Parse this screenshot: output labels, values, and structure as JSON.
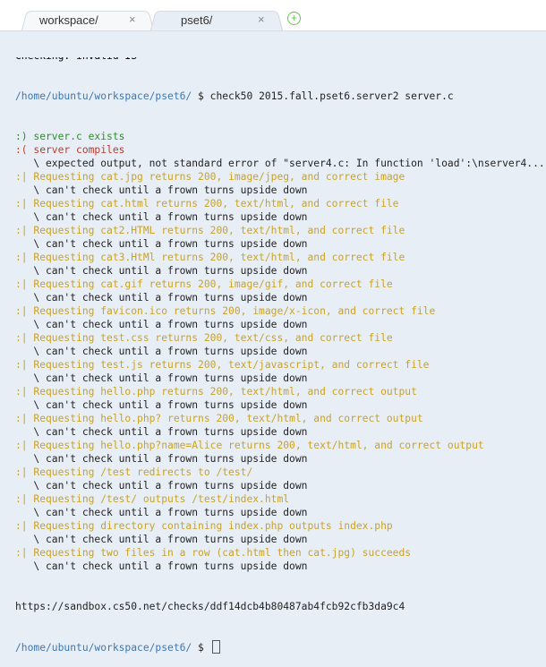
{
  "tabs": [
    {
      "label": "workspace/",
      "close": "×",
      "active": false
    },
    {
      "label": "pset6/",
      "close": "×",
      "active": true
    }
  ],
  "add_tab": "+",
  "terminal": {
    "scrolled_top": "Checking: invalid IS",
    "prompt_path": "/home/ubuntu/workspace/pset6/",
    "prompt_symbol": " $ ",
    "command": "check50 2015.fall.pset6.server2 server.c",
    "results": [
      {
        "status": "ok",
        "text": ":) server.c exists"
      },
      {
        "status": "fail",
        "text": ":( server compiles",
        "detail": "   \\ expected output, not standard error of \"server4.c: In function 'load':\\nserver4...\""
      },
      {
        "status": "warn",
        "text": ":| Requesting cat.jpg returns 200, image/jpeg, and correct image",
        "detail": "   \\ can't check until a frown turns upside down"
      },
      {
        "status": "warn",
        "text": ":| Requesting cat.html returns 200, text/html, and correct file",
        "detail": "   \\ can't check until a frown turns upside down"
      },
      {
        "status": "warn",
        "text": ":| Requesting cat2.HTML returns 200, text/html, and correct file",
        "detail": "   \\ can't check until a frown turns upside down"
      },
      {
        "status": "warn",
        "text": ":| Requesting cat3.HtMl returns 200, text/html, and correct file",
        "detail": "   \\ can't check until a frown turns upside down"
      },
      {
        "status": "warn",
        "text": ":| Requesting cat.gif returns 200, image/gif, and correct file",
        "detail": "   \\ can't check until a frown turns upside down"
      },
      {
        "status": "warn",
        "text": ":| Requesting favicon.ico returns 200, image/x-icon, and correct file",
        "detail": "   \\ can't check until a frown turns upside down"
      },
      {
        "status": "warn",
        "text": ":| Requesting test.css returns 200, text/css, and correct file",
        "detail": "   \\ can't check until a frown turns upside down"
      },
      {
        "status": "warn",
        "text": ":| Requesting test.js returns 200, text/javascript, and correct file",
        "detail": "   \\ can't check until a frown turns upside down"
      },
      {
        "status": "warn",
        "text": ":| Requesting hello.php returns 200, text/html, and correct output",
        "detail": "   \\ can't check until a frown turns upside down"
      },
      {
        "status": "warn",
        "text": ":| Requesting hello.php? returns 200, text/html, and correct output",
        "detail": "   \\ can't check until a frown turns upside down"
      },
      {
        "status": "warn",
        "text": ":| Requesting hello.php?name=Alice returns 200, text/html, and correct output",
        "detail": "   \\ can't check until a frown turns upside down"
      },
      {
        "status": "warn",
        "text": ":| Requesting /test redirects to /test/",
        "detail": "   \\ can't check until a frown turns upside down"
      },
      {
        "status": "warn",
        "text": ":| Requesting /test/ outputs /test/index.html",
        "detail": "   \\ can't check until a frown turns upside down"
      },
      {
        "status": "warn",
        "text": ":| Requesting directory containing index.php outputs index.php",
        "detail": "   \\ can't check until a frown turns upside down"
      },
      {
        "status": "warn",
        "text": ":| Requesting two files in a row (cat.html then cat.jpg) succeeds",
        "detail": "   \\ can't check until a frown turns upside down"
      }
    ],
    "result_url": "https://sandbox.cs50.net/checks/ddf14dcb4b80487ab4fcb92cfb3da9c4",
    "final_prompt_path": "/home/ubuntu/workspace/pset6/",
    "final_prompt_symbol": " $ "
  },
  "colors": {
    "ok": "#2e8b2e",
    "fail": "#c0392b",
    "warn": "#c9a227",
    "path": "#3b78b5",
    "background": "#e8eef6"
  }
}
